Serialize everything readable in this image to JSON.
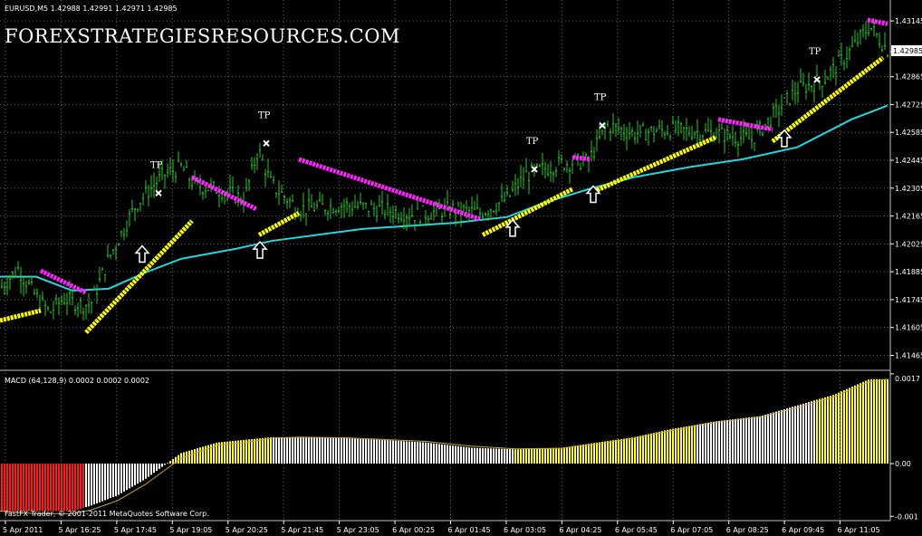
{
  "header": {
    "symbol_line": "EURUSD,M5  1.42988 1.42991 1.42971 1.42985",
    "watermark": "FOREXSTRATEGIESRESOURCES.COM"
  },
  "price_axis": {
    "labels": [
      "1.43145",
      "1.42865",
      "1.42725",
      "1.42585",
      "1.42445",
      "1.42305",
      "1.42165",
      "1.42025",
      "1.41885",
      "1.41745",
      "1.41605",
      "1.41465"
    ],
    "current_price_label": "1.42985",
    "range": [
      1.4139,
      1.4325
    ]
  },
  "macd": {
    "title": "MACD (64,128,9) 0.0002 0.0002 0.0002",
    "axis_labels": [
      "0.0017",
      "0.00",
      "-0.001"
    ],
    "range": [
      -0.00108,
      0.00175
    ]
  },
  "time_axis": {
    "labels": [
      "5 Apr 2011",
      "5 Apr 16:25",
      "5 Apr 17:45",
      "5 Apr 19:05",
      "5 Apr 20:25",
      "5 Apr 21:45",
      "5 Apr 23:05",
      "6 Apr 00:25",
      "6 Apr 01:45",
      "6 Apr 03:05",
      "6 Apr 04:25",
      "6 Apr 05:45",
      "6 Apr 07:05",
      "6 Apr 08:25",
      "6 Apr 09:45",
      "6 Apr 11:05"
    ]
  },
  "footer": {
    "copyright": "FastFX Trader, © 2001-2011 MetaQuotes Software Corp."
  },
  "colors": {
    "background": "#000000",
    "grid": "#5a6a7a",
    "price_bars": "#22c922",
    "moving_average": "#20d8e0",
    "trend_up": "#ffff00",
    "trend_down": "#ff22ff",
    "macd_up": "#ffff33",
    "macd_down": "#ffffff",
    "macd_negative": "#ff1a1a",
    "signal_line": "#c8a040"
  },
  "chart_data": [
    {
      "type": "line",
      "title": "EURUSD,M5",
      "series": [
        {
          "name": "EURUSD",
          "x": [
            0,
            20,
            40,
            55,
            70,
            90,
            100,
            120,
            150,
            180,
            200,
            215,
            240,
            270,
            285,
            300,
            330,
            380,
            420,
            460,
            500,
            530,
            560,
            580,
            600,
            620,
            650,
            670,
            700,
            740,
            790,
            830,
            860,
            880,
            910,
            940,
            960,
            980
          ],
          "values": [
            1.418,
            1.419,
            1.4176,
            1.4168,
            1.4175,
            1.4172,
            1.4172,
            1.4195,
            1.4222,
            1.4237,
            1.4241,
            1.4232,
            1.423,
            1.4225,
            1.425,
            1.4232,
            1.422,
            1.4222,
            1.422,
            1.4217,
            1.422,
            1.4218,
            1.4225,
            1.4237,
            1.424,
            1.4243,
            1.4244,
            1.4262,
            1.4258,
            1.426,
            1.4258,
            1.4255,
            1.427,
            1.428,
            1.4285,
            1.43,
            1.4312,
            1.43
          ]
        }
      ],
      "trend_segments": [
        {
          "color": "trend_up",
          "x": [
            0,
            45
          ],
          "values": [
            1.4164,
            1.4169
          ]
        },
        {
          "color": "trend_down",
          "x": [
            45,
            95
          ],
          "values": [
            1.4189,
            1.4178
          ]
        },
        {
          "color": "trend_up",
          "x": [
            95,
            212
          ],
          "values": [
            1.4158,
            1.4214
          ]
        },
        {
          "color": "trend_down",
          "x": [
            212,
            283
          ],
          "values": [
            1.4236,
            1.422
          ]
        },
        {
          "color": "trend_up",
          "x": [
            286,
            330
          ],
          "values": [
            1.4207,
            1.4218
          ]
        },
        {
          "color": "trend_down",
          "x": [
            330,
            530
          ],
          "values": [
            1.4245,
            1.4215
          ]
        },
        {
          "color": "trend_up",
          "x": [
            533,
            632
          ],
          "values": [
            1.4207,
            1.423
          ]
        },
        {
          "color": "trend_down",
          "x": [
            632,
            652
          ],
          "values": [
            1.4246,
            1.4245
          ]
        },
        {
          "color": "trend_up",
          "x": [
            652,
            790
          ],
          "values": [
            1.4228,
            1.4256
          ]
        },
        {
          "color": "trend_down",
          "x": [
            793,
            853
          ],
          "values": [
            1.4265,
            1.426
          ]
        },
        {
          "color": "trend_up",
          "x": [
            853,
            975
          ],
          "values": [
            1.4254,
            1.4296
          ]
        },
        {
          "color": "trend_down",
          "x": [
            958,
            980
          ],
          "values": [
            1.4315,
            1.4313
          ]
        }
      ],
      "moving_average": {
        "x": [
          0,
          40,
          80,
          120,
          160,
          200,
          260,
          300,
          400,
          500,
          560,
          600,
          650,
          700,
          760,
          820,
          880,
          940,
          980
        ],
        "values": [
          1.4186,
          1.4186,
          1.4179,
          1.418,
          1.4188,
          1.4195,
          1.42,
          1.4204,
          1.421,
          1.4213,
          1.4216,
          1.4223,
          1.423,
          1.4236,
          1.4241,
          1.4245,
          1.4251,
          1.4265,
          1.4272
        ]
      },
      "arrows_up": [
        {
          "x": 157,
          "value": 1.4197
        },
        {
          "x": 287,
          "value": 1.4199
        },
        {
          "x": 566,
          "value": 1.421
        },
        {
          "x": 655,
          "value": 1.4227
        },
        {
          "x": 866,
          "value": 1.4255
        }
      ],
      "take_profit": [
        {
          "x": 175,
          "value": 1.4228,
          "label": "TP"
        },
        {
          "x": 294,
          "value": 1.4253,
          "label": "TP"
        },
        {
          "x": 590,
          "value": 1.424,
          "label": "TP"
        },
        {
          "x": 665,
          "value": 1.4262,
          "label": "TP"
        },
        {
          "x": 902,
          "value": 1.4285,
          "label": "TP"
        }
      ]
    },
    {
      "type": "bar",
      "title": "MACD (64,128,9)",
      "histogram": {
        "x": [
          0,
          40,
          80,
          100,
          130,
          160,
          200,
          240,
          270,
          300,
          330,
          380,
          420,
          470,
          520,
          570,
          620,
          660,
          700,
          740,
          790,
          840,
          880,
          920,
          960,
          980
        ],
        "values": [
          -0.0009,
          -0.0009,
          -0.0009,
          -0.0008,
          -0.0006,
          -0.0003,
          0.0002,
          0.0004,
          0.00045,
          0.0005,
          0.0005,
          0.00048,
          0.00045,
          0.0004,
          0.0003,
          0.00027,
          0.0003,
          0.0004,
          0.0005,
          0.00065,
          0.0008,
          0.0009,
          0.0011,
          0.0013,
          0.0016,
          0.0016
        ]
      },
      "signal": {
        "x": [
          0,
          40,
          80,
          100,
          130,
          160,
          200,
          240,
          270,
          300,
          330,
          380,
          420,
          470,
          520,
          570,
          620,
          660,
          700,
          740,
          790,
          840,
          880,
          920,
          960,
          980
        ],
        "values": [
          -0.0009,
          -0.00095,
          -0.00095,
          -0.00088,
          -0.0007,
          -0.0004,
          0.0001,
          0.00035,
          0.0004,
          0.00048,
          0.0005,
          0.00049,
          0.00046,
          0.00042,
          0.00033,
          0.00028,
          0.00029,
          0.00037,
          0.00048,
          0.00062,
          0.00078,
          0.00088,
          0.00106,
          0.00126,
          0.00155,
          0.0016
        ]
      },
      "bar_color_ranges": [
        {
          "from": 0,
          "to": 95,
          "color": "macd_negative"
        },
        {
          "from": 95,
          "to": 180,
          "color": "macd_down"
        },
        {
          "from": 180,
          "to": 300,
          "color": "macd_up"
        },
        {
          "from": 300,
          "to": 568,
          "color": "macd_down"
        },
        {
          "from": 568,
          "to": 770,
          "color": "macd_up"
        },
        {
          "from": 770,
          "to": 900,
          "color": "macd_down"
        },
        {
          "from": 900,
          "to": 980,
          "color": "macd_up"
        }
      ]
    }
  ]
}
